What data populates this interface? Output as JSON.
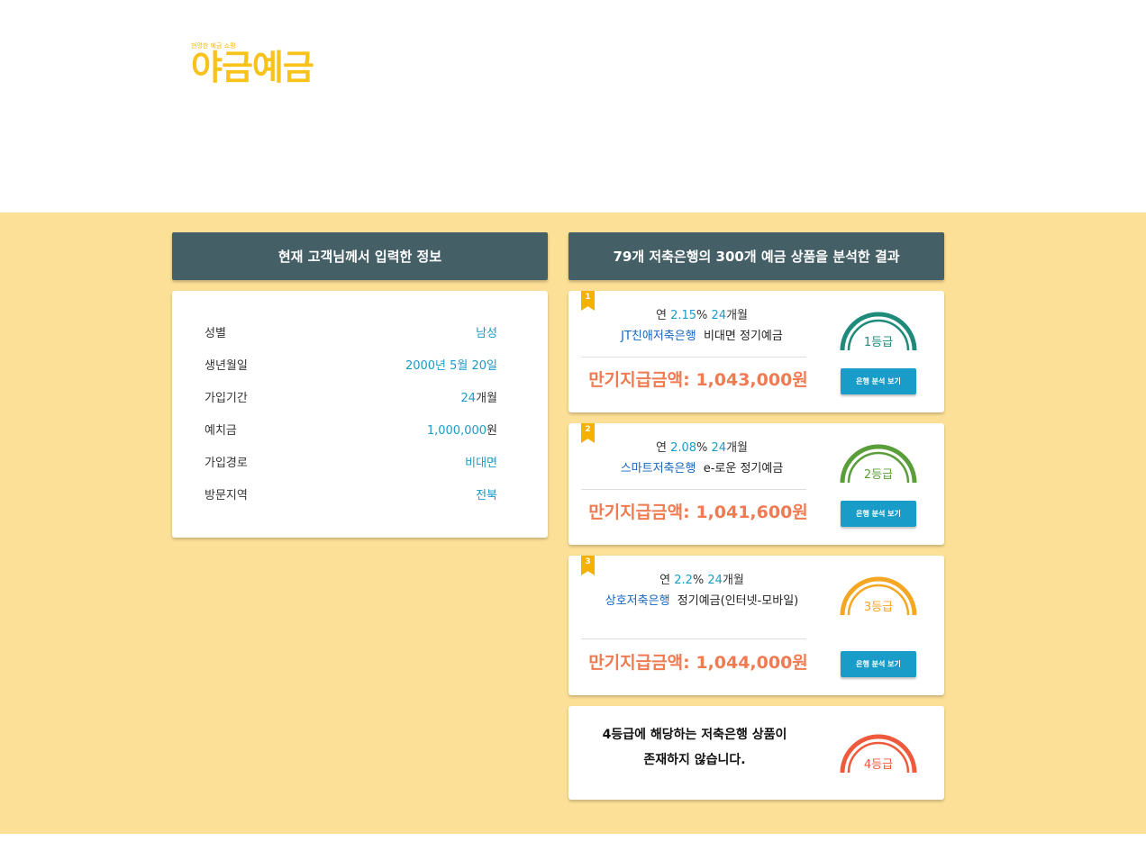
{
  "logo": {
    "tagline": "현명한 예금 쇼핑",
    "name": "야금예금"
  },
  "left": {
    "header": "현재 고객님께서 입력한 정보",
    "rows": [
      {
        "key": "성별",
        "value": "남성",
        "suffix": ""
      },
      {
        "key": "생년월일",
        "value": "2000년 5월 20일",
        "suffix": ""
      },
      {
        "key": "가입기간",
        "value": "24",
        "suffix": "개월"
      },
      {
        "key": "예치금",
        "value": "1,000,000",
        "suffix": "원"
      },
      {
        "key": "가입경로",
        "value": "비대면",
        "suffix": ""
      },
      {
        "key": "방문지역",
        "value": "전북",
        "suffix": ""
      }
    ]
  },
  "right": {
    "header": "79개 저축은행의 300개 예금 상품을 분석한 결과",
    "results": [
      {
        "rank": "1",
        "rate_prefix": "연",
        "rate": "2.15",
        "rate_unit": "%",
        "months": "24",
        "months_unit": "개월",
        "bank": "JT친애저축은행",
        "product": "비대면 정기예금",
        "amount_label": "만기지급금액:",
        "amount": "1,043,000원",
        "grade": "1등급",
        "grade_color": "#1e8a7a",
        "button": "은행 분석 보기"
      },
      {
        "rank": "2",
        "rate_prefix": "연",
        "rate": "2.08",
        "rate_unit": "%",
        "months": "24",
        "months_unit": "개월",
        "bank": "스마트저축은행",
        "product": "e-로운 정기예금",
        "amount_label": "만기지급금액:",
        "amount": "1,041,600원",
        "grade": "2등급",
        "grade_color": "#5a9e3a",
        "button": "은행 분석 보기"
      },
      {
        "rank": "3",
        "rate_prefix": "연",
        "rate": "2.2",
        "rate_unit": "%",
        "months": "24",
        "months_unit": "개월",
        "bank": "상호저축은행",
        "product": "정기예금(인터넷-모바일)",
        "amount_label": "만기지급금액:",
        "amount": "1,044,000원",
        "grade": "3등급",
        "grade_color": "#f5a623",
        "button": "은행 분석 보기"
      }
    ],
    "none": {
      "line1": "4등급에 해당하는 저축은행 상품이",
      "line2": "존재하지 않습니다.",
      "grade": "4등급",
      "grade_color": "#f05a3c"
    }
  }
}
